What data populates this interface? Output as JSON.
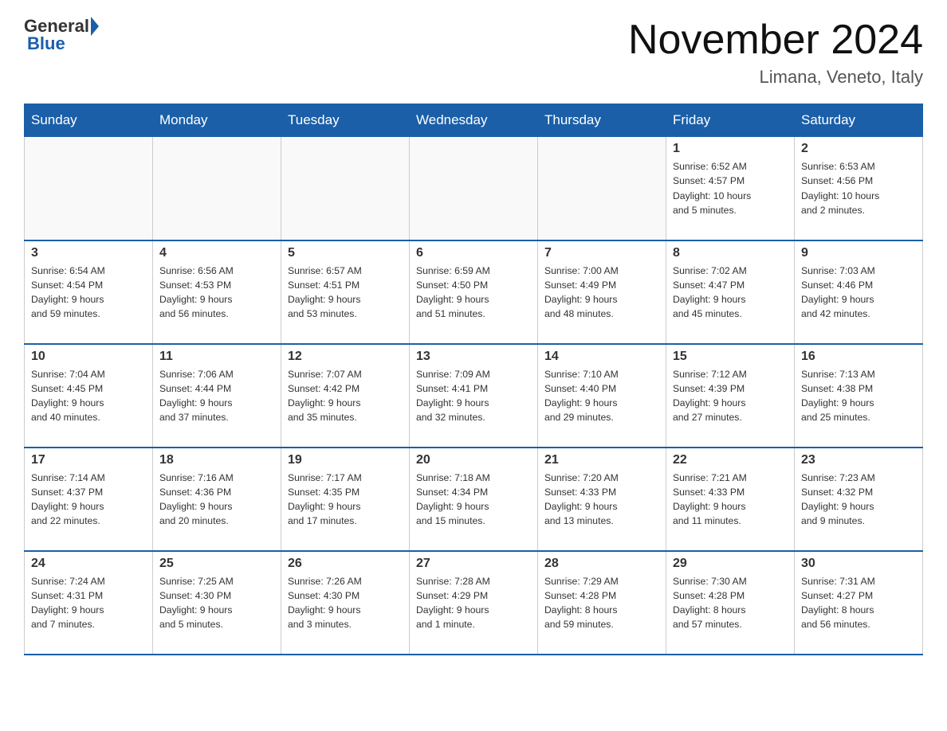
{
  "header": {
    "logo_general": "General",
    "logo_blue": "Blue",
    "title": "November 2024",
    "subtitle": "Limana, Veneto, Italy"
  },
  "weekdays": [
    "Sunday",
    "Monday",
    "Tuesday",
    "Wednesday",
    "Thursday",
    "Friday",
    "Saturday"
  ],
  "weeks": [
    [
      {
        "day": "",
        "info": ""
      },
      {
        "day": "",
        "info": ""
      },
      {
        "day": "",
        "info": ""
      },
      {
        "day": "",
        "info": ""
      },
      {
        "day": "",
        "info": ""
      },
      {
        "day": "1",
        "info": "Sunrise: 6:52 AM\nSunset: 4:57 PM\nDaylight: 10 hours\nand 5 minutes."
      },
      {
        "day": "2",
        "info": "Sunrise: 6:53 AM\nSunset: 4:56 PM\nDaylight: 10 hours\nand 2 minutes."
      }
    ],
    [
      {
        "day": "3",
        "info": "Sunrise: 6:54 AM\nSunset: 4:54 PM\nDaylight: 9 hours\nand 59 minutes."
      },
      {
        "day": "4",
        "info": "Sunrise: 6:56 AM\nSunset: 4:53 PM\nDaylight: 9 hours\nand 56 minutes."
      },
      {
        "day": "5",
        "info": "Sunrise: 6:57 AM\nSunset: 4:51 PM\nDaylight: 9 hours\nand 53 minutes."
      },
      {
        "day": "6",
        "info": "Sunrise: 6:59 AM\nSunset: 4:50 PM\nDaylight: 9 hours\nand 51 minutes."
      },
      {
        "day": "7",
        "info": "Sunrise: 7:00 AM\nSunset: 4:49 PM\nDaylight: 9 hours\nand 48 minutes."
      },
      {
        "day": "8",
        "info": "Sunrise: 7:02 AM\nSunset: 4:47 PM\nDaylight: 9 hours\nand 45 minutes."
      },
      {
        "day": "9",
        "info": "Sunrise: 7:03 AM\nSunset: 4:46 PM\nDaylight: 9 hours\nand 42 minutes."
      }
    ],
    [
      {
        "day": "10",
        "info": "Sunrise: 7:04 AM\nSunset: 4:45 PM\nDaylight: 9 hours\nand 40 minutes."
      },
      {
        "day": "11",
        "info": "Sunrise: 7:06 AM\nSunset: 4:44 PM\nDaylight: 9 hours\nand 37 minutes."
      },
      {
        "day": "12",
        "info": "Sunrise: 7:07 AM\nSunset: 4:42 PM\nDaylight: 9 hours\nand 35 minutes."
      },
      {
        "day": "13",
        "info": "Sunrise: 7:09 AM\nSunset: 4:41 PM\nDaylight: 9 hours\nand 32 minutes."
      },
      {
        "day": "14",
        "info": "Sunrise: 7:10 AM\nSunset: 4:40 PM\nDaylight: 9 hours\nand 29 minutes."
      },
      {
        "day": "15",
        "info": "Sunrise: 7:12 AM\nSunset: 4:39 PM\nDaylight: 9 hours\nand 27 minutes."
      },
      {
        "day": "16",
        "info": "Sunrise: 7:13 AM\nSunset: 4:38 PM\nDaylight: 9 hours\nand 25 minutes."
      }
    ],
    [
      {
        "day": "17",
        "info": "Sunrise: 7:14 AM\nSunset: 4:37 PM\nDaylight: 9 hours\nand 22 minutes."
      },
      {
        "day": "18",
        "info": "Sunrise: 7:16 AM\nSunset: 4:36 PM\nDaylight: 9 hours\nand 20 minutes."
      },
      {
        "day": "19",
        "info": "Sunrise: 7:17 AM\nSunset: 4:35 PM\nDaylight: 9 hours\nand 17 minutes."
      },
      {
        "day": "20",
        "info": "Sunrise: 7:18 AM\nSunset: 4:34 PM\nDaylight: 9 hours\nand 15 minutes."
      },
      {
        "day": "21",
        "info": "Sunrise: 7:20 AM\nSunset: 4:33 PM\nDaylight: 9 hours\nand 13 minutes."
      },
      {
        "day": "22",
        "info": "Sunrise: 7:21 AM\nSunset: 4:33 PM\nDaylight: 9 hours\nand 11 minutes."
      },
      {
        "day": "23",
        "info": "Sunrise: 7:23 AM\nSunset: 4:32 PM\nDaylight: 9 hours\nand 9 minutes."
      }
    ],
    [
      {
        "day": "24",
        "info": "Sunrise: 7:24 AM\nSunset: 4:31 PM\nDaylight: 9 hours\nand 7 minutes."
      },
      {
        "day": "25",
        "info": "Sunrise: 7:25 AM\nSunset: 4:30 PM\nDaylight: 9 hours\nand 5 minutes."
      },
      {
        "day": "26",
        "info": "Sunrise: 7:26 AM\nSunset: 4:30 PM\nDaylight: 9 hours\nand 3 minutes."
      },
      {
        "day": "27",
        "info": "Sunrise: 7:28 AM\nSunset: 4:29 PM\nDaylight: 9 hours\nand 1 minute."
      },
      {
        "day": "28",
        "info": "Sunrise: 7:29 AM\nSunset: 4:28 PM\nDaylight: 8 hours\nand 59 minutes."
      },
      {
        "day": "29",
        "info": "Sunrise: 7:30 AM\nSunset: 4:28 PM\nDaylight: 8 hours\nand 57 minutes."
      },
      {
        "day": "30",
        "info": "Sunrise: 7:31 AM\nSunset: 4:27 PM\nDaylight: 8 hours\nand 56 minutes."
      }
    ]
  ]
}
